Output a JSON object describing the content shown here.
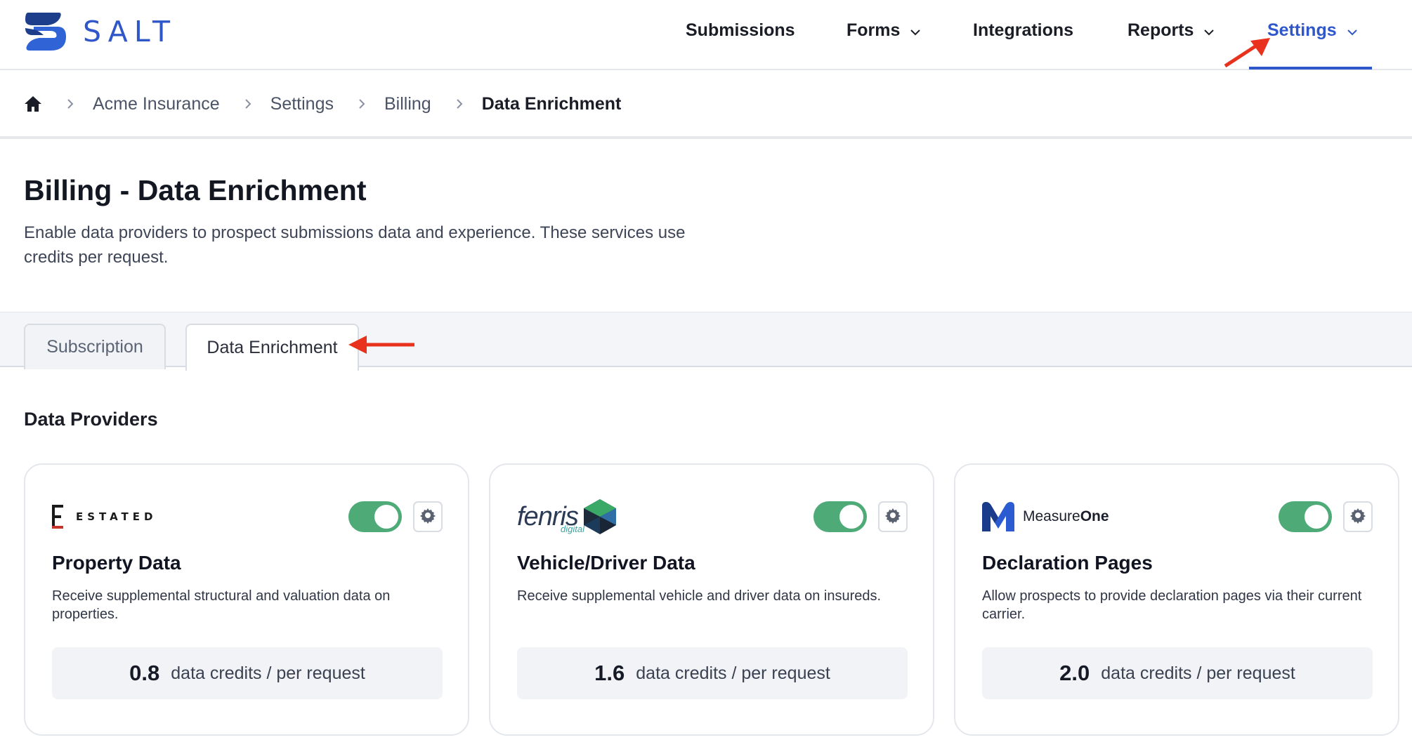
{
  "brand": {
    "name": "SALT",
    "primary_color": "#2f57c9",
    "accent_color": "#4eab77"
  },
  "nav": {
    "items": [
      {
        "label": "Submissions",
        "dropdown": false
      },
      {
        "label": "Forms",
        "dropdown": true
      },
      {
        "label": "Integrations",
        "dropdown": false
      },
      {
        "label": "Reports",
        "dropdown": true
      },
      {
        "label": "Settings",
        "dropdown": true,
        "active": true
      }
    ]
  },
  "breadcrumb": {
    "home_icon": "home-icon",
    "items": [
      "Acme Insurance",
      "Settings",
      "Billing"
    ],
    "current": "Data Enrichment"
  },
  "page": {
    "title": "Billing - Data Enrichment",
    "description": "Enable data providers to prospect submissions data and experience. These services use credits per request."
  },
  "tabs": [
    {
      "label": "Subscription",
      "active": false
    },
    {
      "label": "Data Enrichment",
      "active": true
    }
  ],
  "section": {
    "title": "Data Providers"
  },
  "providers": [
    {
      "logo_text": "ESTATED",
      "logo_mark": "E",
      "enabled": true,
      "title": "Property Data",
      "description": "Receive supplemental structural and valuation data on properties.",
      "credits": "0.8",
      "credits_unit": "data credits / per request"
    },
    {
      "logo_text": "fenris",
      "logo_subtext": "digital",
      "enabled": true,
      "title": "Vehicle/Driver Data",
      "description": "Receive supplemental vehicle and driver data on insureds.",
      "credits": "1.6",
      "credits_unit": "data credits / per request"
    },
    {
      "logo_text_a": "Measure",
      "logo_text_b": "One",
      "logo_mark": "M",
      "enabled": true,
      "title": "Declaration Pages",
      "description": "Allow prospects to provide declaration pages via their current carrier.",
      "credits": "2.0",
      "credits_unit": "data credits / per request"
    }
  ],
  "annotations": {
    "arrow_color": "#e8321e"
  }
}
